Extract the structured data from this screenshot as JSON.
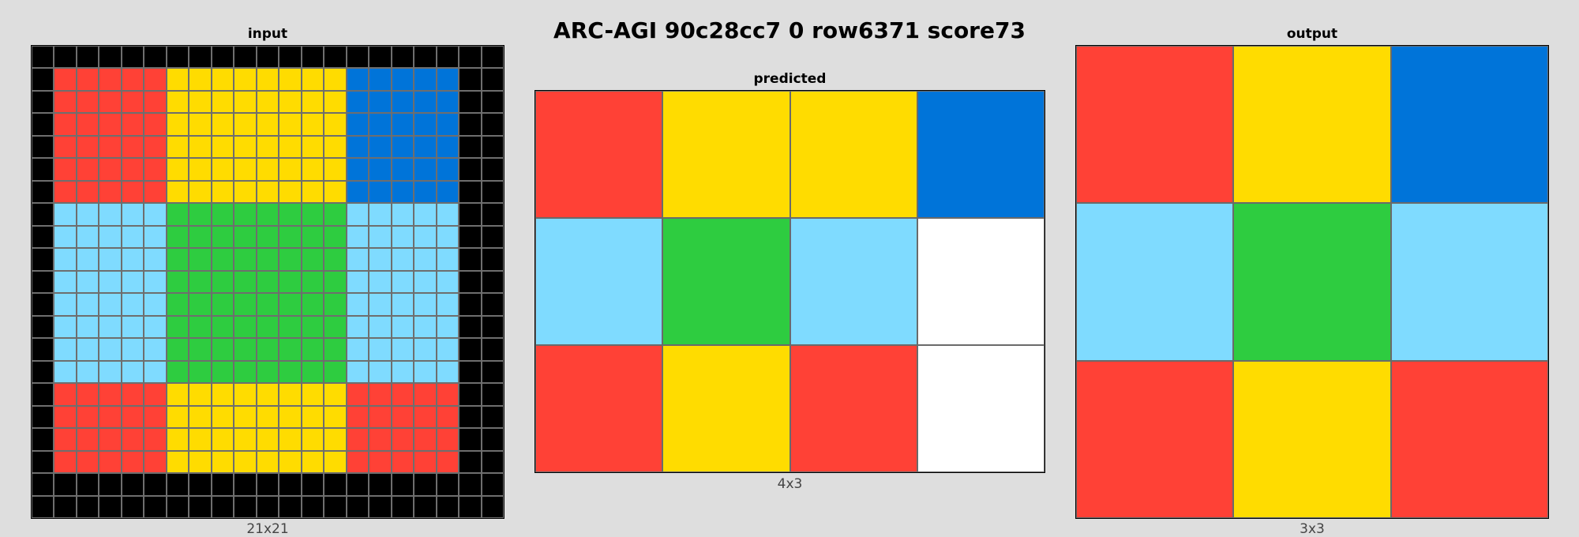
{
  "title": "ARC-AGI 90c28cc7 0 row6371 score73",
  "palette": {
    "0": "#000000",
    "1": "#0074D9",
    "2": "#FF4136",
    "3": "#2ECC40",
    "4": "#FFDC00",
    "5": "#AAAAAA",
    "6": "#F012BE",
    "7": "#FF851B",
    "8": "#7FDBFF",
    "9": "#870C25",
    "10": "#FFFFFF"
  },
  "panels": {
    "input": {
      "title": "input",
      "caption": "21x21",
      "grid": [
        [
          0,
          0,
          0,
          0,
          0,
          0,
          0,
          0,
          0,
          0,
          0,
          0,
          0,
          0,
          0,
          0,
          0,
          0,
          0,
          0,
          0
        ],
        [
          0,
          2,
          2,
          2,
          2,
          2,
          4,
          4,
          4,
          4,
          4,
          4,
          4,
          4,
          1,
          1,
          1,
          1,
          1,
          0,
          0
        ],
        [
          0,
          2,
          2,
          2,
          2,
          2,
          4,
          4,
          4,
          4,
          4,
          4,
          4,
          4,
          1,
          1,
          1,
          1,
          1,
          0,
          0
        ],
        [
          0,
          2,
          2,
          2,
          2,
          2,
          4,
          4,
          4,
          4,
          4,
          4,
          4,
          4,
          1,
          1,
          1,
          1,
          1,
          0,
          0
        ],
        [
          0,
          2,
          2,
          2,
          2,
          2,
          4,
          4,
          4,
          4,
          4,
          4,
          4,
          4,
          1,
          1,
          1,
          1,
          1,
          0,
          0
        ],
        [
          0,
          2,
          2,
          2,
          2,
          2,
          4,
          4,
          4,
          4,
          4,
          4,
          4,
          4,
          1,
          1,
          1,
          1,
          1,
          0,
          0
        ],
        [
          0,
          2,
          2,
          2,
          2,
          2,
          4,
          4,
          4,
          4,
          4,
          4,
          4,
          4,
          1,
          1,
          1,
          1,
          1,
          0,
          0
        ],
        [
          0,
          8,
          8,
          8,
          8,
          8,
          3,
          3,
          3,
          3,
          3,
          3,
          3,
          3,
          8,
          8,
          8,
          8,
          8,
          0,
          0
        ],
        [
          0,
          8,
          8,
          8,
          8,
          8,
          3,
          3,
          3,
          3,
          3,
          3,
          3,
          3,
          8,
          8,
          8,
          8,
          8,
          0,
          0
        ],
        [
          0,
          8,
          8,
          8,
          8,
          8,
          3,
          3,
          3,
          3,
          3,
          3,
          3,
          3,
          8,
          8,
          8,
          8,
          8,
          0,
          0
        ],
        [
          0,
          8,
          8,
          8,
          8,
          8,
          3,
          3,
          3,
          3,
          3,
          3,
          3,
          3,
          8,
          8,
          8,
          8,
          8,
          0,
          0
        ],
        [
          0,
          8,
          8,
          8,
          8,
          8,
          3,
          3,
          3,
          3,
          3,
          3,
          3,
          3,
          8,
          8,
          8,
          8,
          8,
          0,
          0
        ],
        [
          0,
          8,
          8,
          8,
          8,
          8,
          3,
          3,
          3,
          3,
          3,
          3,
          3,
          3,
          8,
          8,
          8,
          8,
          8,
          0,
          0
        ],
        [
          0,
          8,
          8,
          8,
          8,
          8,
          3,
          3,
          3,
          3,
          3,
          3,
          3,
          3,
          8,
          8,
          8,
          8,
          8,
          0,
          0
        ],
        [
          0,
          8,
          8,
          8,
          8,
          8,
          3,
          3,
          3,
          3,
          3,
          3,
          3,
          3,
          8,
          8,
          8,
          8,
          8,
          0,
          0
        ],
        [
          0,
          2,
          2,
          2,
          2,
          2,
          4,
          4,
          4,
          4,
          4,
          4,
          4,
          4,
          2,
          2,
          2,
          2,
          2,
          0,
          0
        ],
        [
          0,
          2,
          2,
          2,
          2,
          2,
          4,
          4,
          4,
          4,
          4,
          4,
          4,
          4,
          2,
          2,
          2,
          2,
          2,
          0,
          0
        ],
        [
          0,
          2,
          2,
          2,
          2,
          2,
          4,
          4,
          4,
          4,
          4,
          4,
          4,
          4,
          2,
          2,
          2,
          2,
          2,
          0,
          0
        ],
        [
          0,
          2,
          2,
          2,
          2,
          2,
          4,
          4,
          4,
          4,
          4,
          4,
          4,
          4,
          2,
          2,
          2,
          2,
          2,
          0,
          0
        ],
        [
          0,
          0,
          0,
          0,
          0,
          0,
          0,
          0,
          0,
          0,
          0,
          0,
          0,
          0,
          0,
          0,
          0,
          0,
          0,
          0,
          0
        ],
        [
          0,
          0,
          0,
          0,
          0,
          0,
          0,
          0,
          0,
          0,
          0,
          0,
          0,
          0,
          0,
          0,
          0,
          0,
          0,
          0,
          0
        ]
      ]
    },
    "predicted": {
      "title": "predicted",
      "caption": "4x3",
      "grid": [
        [
          2,
          4,
          4,
          1
        ],
        [
          8,
          3,
          8,
          10
        ],
        [
          2,
          4,
          2,
          10
        ]
      ]
    },
    "output": {
      "title": "output",
      "caption": "3x3",
      "grid": [
        [
          2,
          4,
          1
        ],
        [
          8,
          3,
          8
        ],
        [
          2,
          4,
          2
        ]
      ]
    }
  }
}
